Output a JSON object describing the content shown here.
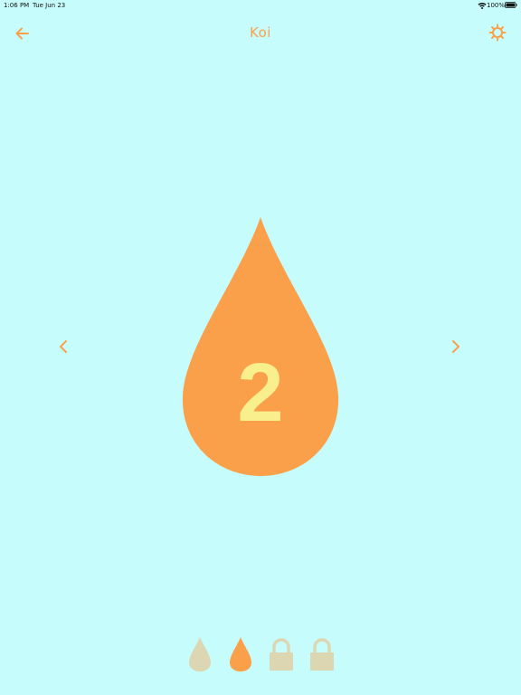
{
  "status_bar": {
    "time": "1:06 PM",
    "date": "Tue Jun 23",
    "battery_percent": "100%",
    "wifi_icon": "wifi-icon",
    "battery_icon": "battery-full-icon"
  },
  "nav": {
    "title": "Koi",
    "back_icon": "arrow-left-icon",
    "settings_icon": "gear-icon"
  },
  "main": {
    "current_level": "2",
    "prev_icon": "chevron-left-icon",
    "next_icon": "chevron-right-icon"
  },
  "levels": [
    {
      "state": "unlocked",
      "icon": "drop-icon"
    },
    {
      "state": "selected",
      "icon": "drop-icon"
    },
    {
      "state": "locked",
      "icon": "lock-icon"
    },
    {
      "state": "locked",
      "icon": "lock-icon"
    }
  ],
  "colors": {
    "background": "#c6fdfc",
    "accent": "#fba04a",
    "number": "#f9ef8c",
    "inactive": "#ddd6b3"
  }
}
